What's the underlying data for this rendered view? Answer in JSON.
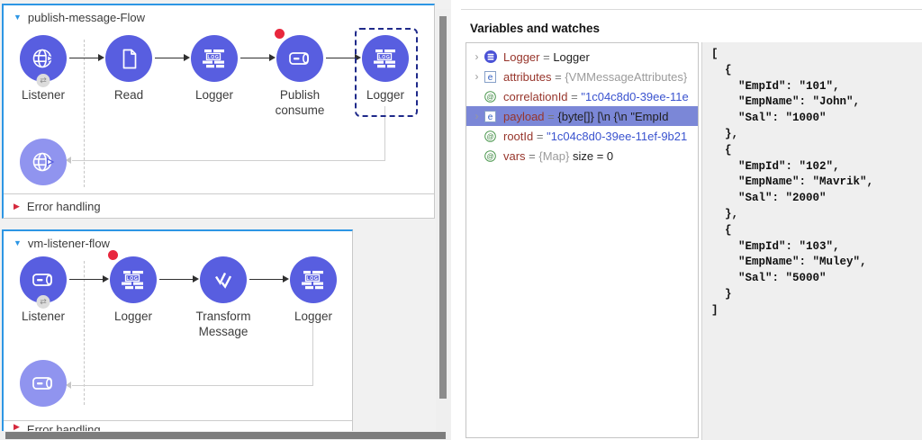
{
  "colors": {
    "node_fill": "#585ee0",
    "node_fill_faded": "#9094ef",
    "flow_selection_blue": "#2d96e4",
    "breakpoint_red": "#e8273d",
    "tree_selection": "#7b87d7",
    "variable_name": "#97352b",
    "string_value": "#3a53cf"
  },
  "left_editor": {
    "flows": [
      {
        "title": "publish-message-Flow",
        "error_label": "Error handling",
        "nodes": [
          {
            "label": "Listener",
            "icon": "http-listener-icon",
            "badge": true
          },
          {
            "label": "Read",
            "icon": "read-icon"
          },
          {
            "label": "Logger",
            "icon": "logger-icon"
          },
          {
            "label": "Publish consume",
            "icon": "vm-icon",
            "breakpoint": true
          },
          {
            "label": "Logger",
            "icon": "logger-icon",
            "selected": true
          }
        ],
        "response": {
          "icon": "http-listener-icon"
        }
      },
      {
        "title": "vm-listener-flow",
        "error_label": "Error handling",
        "nodes": [
          {
            "label": "Listener",
            "icon": "vm-icon",
            "badge": true
          },
          {
            "label": "Logger",
            "icon": "logger-icon",
            "breakpoint": true
          },
          {
            "label": "Transform Message",
            "icon": "transform-icon"
          },
          {
            "label": "Logger",
            "icon": "logger-icon"
          }
        ],
        "response": {
          "icon": "vm-icon"
        }
      }
    ]
  },
  "variables_panel": {
    "title": "Variables and watches",
    "rows": [
      {
        "key": "logger",
        "chevron": true,
        "icon": "logger-circle-icon",
        "parts": [
          {
            "t": "Logger",
            "s": "name"
          },
          {
            "t": " = ",
            "s": "eq"
          },
          {
            "t": "Logger",
            "s": "plain"
          }
        ]
      },
      {
        "key": "attributes",
        "chevron": true,
        "icon": "e-square-icon",
        "parts": [
          {
            "t": "attributes",
            "s": "name"
          },
          {
            "t": " = ",
            "s": "eq"
          },
          {
            "t": "{VMMessageAttributes}",
            "s": "muted"
          }
        ]
      },
      {
        "key": "correlationId",
        "chevron": false,
        "icon": "a-circle-icon",
        "parts": [
          {
            "t": "correlationId",
            "s": "name"
          },
          {
            "t": " = ",
            "s": "eq"
          },
          {
            "t": "\"1c04c8d0-39ee-11e",
            "s": "string"
          }
        ]
      },
      {
        "key": "payload",
        "chevron": true,
        "selected": true,
        "icon": "e-square-icon",
        "parts": [
          {
            "t": "payload",
            "s": "name"
          },
          {
            "t": " = ",
            "s": "eq"
          },
          {
            "t": "{byte[]} [\\n {\\n   \"EmpId",
            "s": "plain"
          }
        ]
      },
      {
        "key": "rootId",
        "chevron": false,
        "icon": "a-circle-icon",
        "parts": [
          {
            "t": "rootId",
            "s": "name"
          },
          {
            "t": " = ",
            "s": "eq"
          },
          {
            "t": "\"1c04c8d0-39ee-11ef-9b21",
            "s": "string"
          }
        ]
      },
      {
        "key": "vars",
        "chevron": false,
        "icon": "a-circle-icon",
        "parts": [
          {
            "t": "vars",
            "s": "name"
          },
          {
            "t": " = ",
            "s": "eq"
          },
          {
            "t": "{Map}",
            "s": "muted"
          },
          {
            "t": " size = 0",
            "s": "plain"
          }
        ]
      }
    ],
    "detail_lines": [
      "[",
      "  {",
      "    \"EmpId\": \"101\",",
      "    \"EmpName\": \"John\",",
      "    \"Sal\": \"1000\"",
      "  },",
      "  {",
      "    \"EmpId\": \"102\",",
      "    \"EmpName\": \"Mavrik\",",
      "    \"Sal\": \"2000\"",
      "  },",
      "  {",
      "    \"EmpId\": \"103\",",
      "    \"EmpName\": \"Muley\",",
      "    \"Sal\": \"5000\"",
      "  }",
      "]"
    ]
  }
}
